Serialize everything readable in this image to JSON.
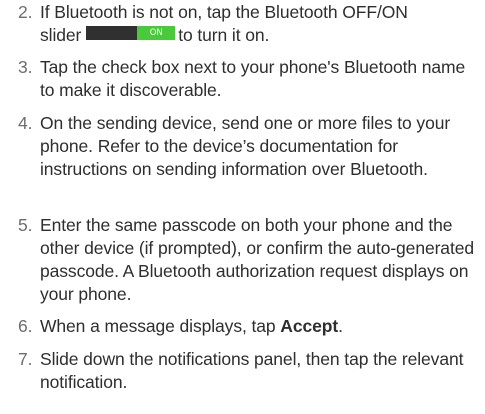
{
  "steps": [
    {
      "num": "2.",
      "line1": "If Bluetooth is not on, tap the Bluetooth OFF/ON",
      "line2_pre": "slider",
      "slider_label": "ON",
      "line2_post": "to turn it on."
    },
    {
      "num": "3.",
      "text": "Tap the check box next to your phone's Bluetooth name to make it discoverable."
    },
    {
      "num": "4.",
      "text": "On the sending device, send one or more files to your phone. Refer to the device’s documentation for instructions on sending information over Bluetooth."
    },
    {
      "num": "5.",
      "text": "Enter the same passcode on both your phone and the other device (if prompted), or confirm the auto-generated passcode. A Bluetooth authorization request displays on your phone."
    },
    {
      "num": "6.",
      "pre": "When a message displays, tap",
      "bold": "Accept",
      "post": "."
    },
    {
      "num": "7.",
      "text": "Slide down the notifications panel, then tap the relevant notification."
    }
  ]
}
